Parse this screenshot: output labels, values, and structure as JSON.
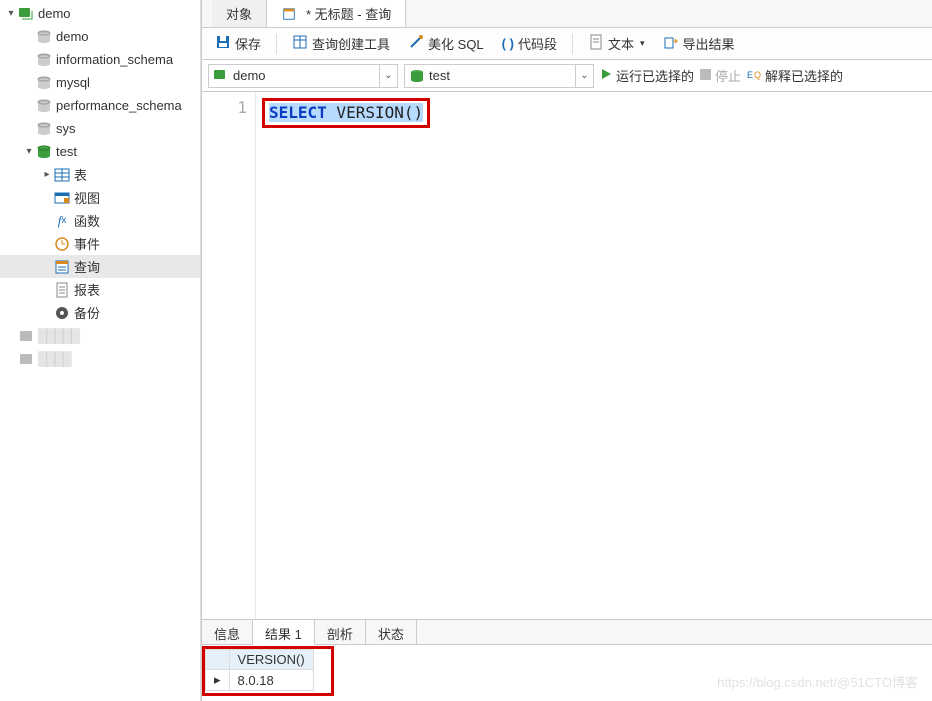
{
  "sidebar": {
    "root": {
      "name": "demo",
      "expanded": true
    },
    "children": [
      {
        "name": "demo"
      },
      {
        "name": "information_schema"
      },
      {
        "name": "mysql"
      },
      {
        "name": "performance_schema"
      },
      {
        "name": "sys"
      },
      {
        "name": "test",
        "expanded": true,
        "children": [
          {
            "name": "表",
            "icon": "table"
          },
          {
            "name": "视图",
            "icon": "view"
          },
          {
            "name": "函数",
            "icon": "fx"
          },
          {
            "name": "事件",
            "icon": "event"
          },
          {
            "name": "查询",
            "icon": "query",
            "selected": true
          },
          {
            "name": "报表",
            "icon": "report"
          },
          {
            "name": "备份",
            "icon": "backup"
          }
        ]
      }
    ]
  },
  "tabs": {
    "t1": "对象",
    "t2": "* 无标题 - 查询"
  },
  "toolbar": {
    "save": "保存",
    "builder": "查询创建工具",
    "beautify": "美化 SQL",
    "snippet": "代码段",
    "text": "文本",
    "export": "导出结果"
  },
  "selectors": {
    "db": "demo",
    "schema": "test",
    "run": "运行已选择的",
    "stop": "停止",
    "explain": "解释已选择的"
  },
  "editor": {
    "line": "1",
    "kw": "SELECT",
    "rest": " VERSION()"
  },
  "bottomTabs": {
    "info": "信息",
    "result": "结果 1",
    "profile": "剖析",
    "status": "状态"
  },
  "result": {
    "col": "VERSION()",
    "val": "8.0.18"
  },
  "watermark": "https://blog.csdn.net/@51CTO博客",
  "colors": {
    "green": "#3a9c3a",
    "blue": "#1a6db5",
    "red": "#d40000",
    "orange": "#d88a1e"
  }
}
